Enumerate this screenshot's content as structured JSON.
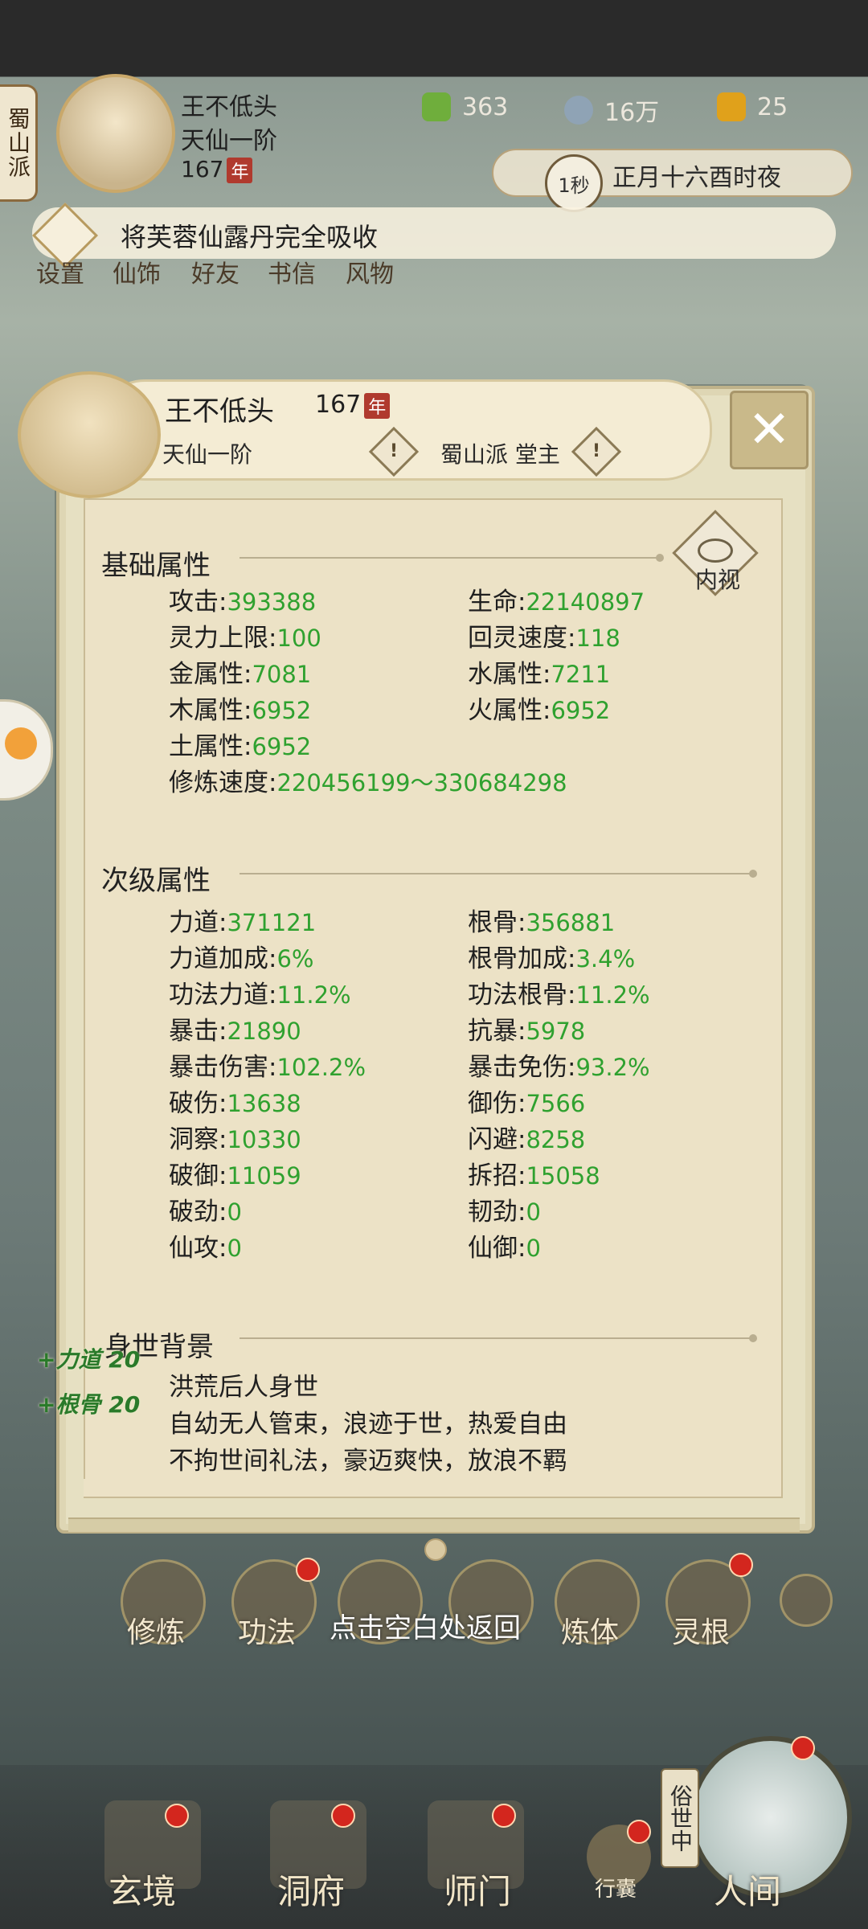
{
  "top": {
    "sect": "蜀山派",
    "name": "王不低头",
    "rank": "天仙一阶",
    "age": "167",
    "age_badge": "年",
    "res_jade": "363",
    "res_coin": "16万",
    "res_gold": "25",
    "time_label": "1秒",
    "date_text": "正月十六酉时夜",
    "notice": "将芙蓉仙露丹完全吸收",
    "menu": [
      "设置",
      "仙饰",
      "好友",
      "书信",
      "风物"
    ]
  },
  "dialog": {
    "name": "王不低头",
    "age": "167",
    "age_badge": "年",
    "rank": "天仙一阶",
    "sect": "蜀山派 堂主",
    "warn_glyph": "!",
    "close_glyph": "✕",
    "eye_label": "内视",
    "basic": {
      "title": "基础属性",
      "rows": [
        [
          {
            "k": "攻击",
            "v": "393388"
          },
          {
            "k": "生命",
            "v": "22140897"
          }
        ],
        [
          {
            "k": "灵力上限",
            "v": "100"
          },
          {
            "k": "回灵速度",
            "v": "118"
          }
        ],
        [
          {
            "k": "金属性",
            "v": "7081"
          },
          {
            "k": "水属性",
            "v": "7211"
          }
        ],
        [
          {
            "k": "木属性",
            "v": "6952"
          },
          {
            "k": "火属性",
            "v": "6952"
          }
        ],
        [
          {
            "k": "土属性",
            "v": "6952"
          }
        ],
        [
          {
            "k": "修炼速度",
            "v": "220456199～330684298"
          }
        ]
      ]
    },
    "secondary": {
      "title": "次级属性",
      "rows": [
        [
          {
            "k": "力道",
            "v": "371121"
          },
          {
            "k": "根骨",
            "v": "356881"
          }
        ],
        [
          {
            "k": "力道加成",
            "v": "6%"
          },
          {
            "k": "根骨加成",
            "v": "3.4%"
          }
        ],
        [
          {
            "k": "功法力道",
            "v": "11.2%"
          },
          {
            "k": "功法根骨",
            "v": "11.2%"
          }
        ],
        [
          {
            "k": "暴击",
            "v": "21890"
          },
          {
            "k": "抗暴",
            "v": "5978"
          }
        ],
        [
          {
            "k": "暴击伤害",
            "v": "102.2%"
          },
          {
            "k": "暴击免伤",
            "v": "93.2%"
          }
        ],
        [
          {
            "k": "破伤",
            "v": "13638"
          },
          {
            "k": "御伤",
            "v": "7566"
          }
        ],
        [
          {
            "k": "洞察",
            "v": "10330"
          },
          {
            "k": "闪避",
            "v": "8258"
          }
        ],
        [
          {
            "k": "破御",
            "v": "11059"
          },
          {
            "k": "拆招",
            "v": "15058"
          }
        ],
        [
          {
            "k": "破劲",
            "v": "0"
          },
          {
            "k": "韧劲",
            "v": "0"
          }
        ],
        [
          {
            "k": "仙攻",
            "v": "0"
          },
          {
            "k": "仙御",
            "v": "0"
          }
        ]
      ]
    },
    "bio": {
      "title": "身世背景",
      "lines": [
        "洪荒后人身世",
        "自幼无人管束，浪迹于世，热爱自由",
        "不拘世间礼法，豪迈爽快，放浪不羁"
      ]
    },
    "buffs": [
      "+力道 20",
      "+根骨 20"
    ]
  },
  "under_row": {
    "labels": [
      "修炼",
      "功法",
      "点击空白处返回",
      "炼体",
      "灵根"
    ]
  },
  "bottom_nav": {
    "items": [
      "玄境",
      "洞府",
      "师门"
    ],
    "bag": "行囊",
    "world_tag": "俗世中",
    "world": "人间"
  }
}
